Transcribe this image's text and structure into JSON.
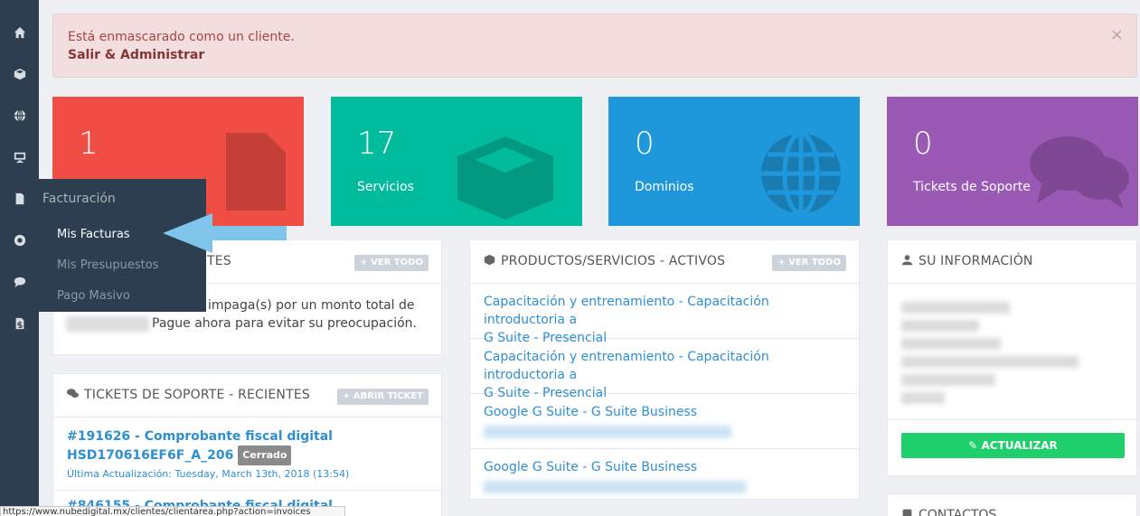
{
  "sidebar": {
    "icons": [
      "home-icon",
      "cube-icon",
      "globe-icon",
      "monitor-icon",
      "file-icon",
      "lifering-icon",
      "comment-icon",
      "file-dollar-icon"
    ]
  },
  "flyout": {
    "title": "Facturación",
    "items": [
      {
        "label": "Mis Facturas"
      },
      {
        "label": "Mis Presupuestos"
      },
      {
        "label": "Pago Masivo"
      }
    ]
  },
  "alert": {
    "text": "Está enmascarado como un cliente.",
    "link": "Salir & Administrar",
    "close": "×"
  },
  "tiles": [
    {
      "number": "1",
      "label": "",
      "color": "#f04e45",
      "icon": "file-icon"
    },
    {
      "number": "17",
      "label": "Servicios",
      "color": "#00bc9c",
      "icon": "cube-icon"
    },
    {
      "number": "0",
      "label": "Dominios",
      "color": "#1e98da",
      "icon": "globe-icon"
    },
    {
      "number": "0",
      "label": "Tickets de Soporte",
      "color": "#9b59b6",
      "icon": "comments-icon"
    }
  ],
  "invoices": {
    "title_tail": "TES",
    "button": "VER TODO",
    "text_line1": "impaga(s) por un monto total de",
    "text_line2": "Pague ahora para evitar su preocupación."
  },
  "tickets": {
    "title": "TICKETS DE SOPORTE - RECIENTES",
    "button": "ABRIR TICKET",
    "items": [
      {
        "title_line1": "#191626 - Comprobante fiscal digital",
        "title_line2": "HSD170616EF6F_A_206",
        "status": "Cerrado",
        "updated": "Última Actualización: Tuesday, March 13th, 2018 (13:54)"
      },
      {
        "title_line1": "#846155 - Comprobante fiscal digital"
      }
    ]
  },
  "products": {
    "title": "PRODUCTOS/SERVICIOS - ACTIVOS",
    "button": "VER TODO",
    "items": [
      {
        "line1": "Capacitación y entrenamiento - Capacitación introductoria a",
        "line2": "G Suite - Presencial"
      },
      {
        "line1": "Capacitación y entrenamiento - Capacitación introductoria a",
        "line2": "G Suite - Presencial"
      },
      {
        "line1": "Google G Suite - G Suite Business"
      },
      {
        "line1": "Google G Suite - G Suite Business"
      }
    ]
  },
  "info": {
    "title": "SU INFORMACIÓN",
    "button": "ACTUALIZAR"
  },
  "contacts": {
    "title": "CONTACTOS"
  },
  "statusbar": {
    "url": "https://www.nubedigital.mx/clientes/clientarea.php?action=invoices"
  }
}
